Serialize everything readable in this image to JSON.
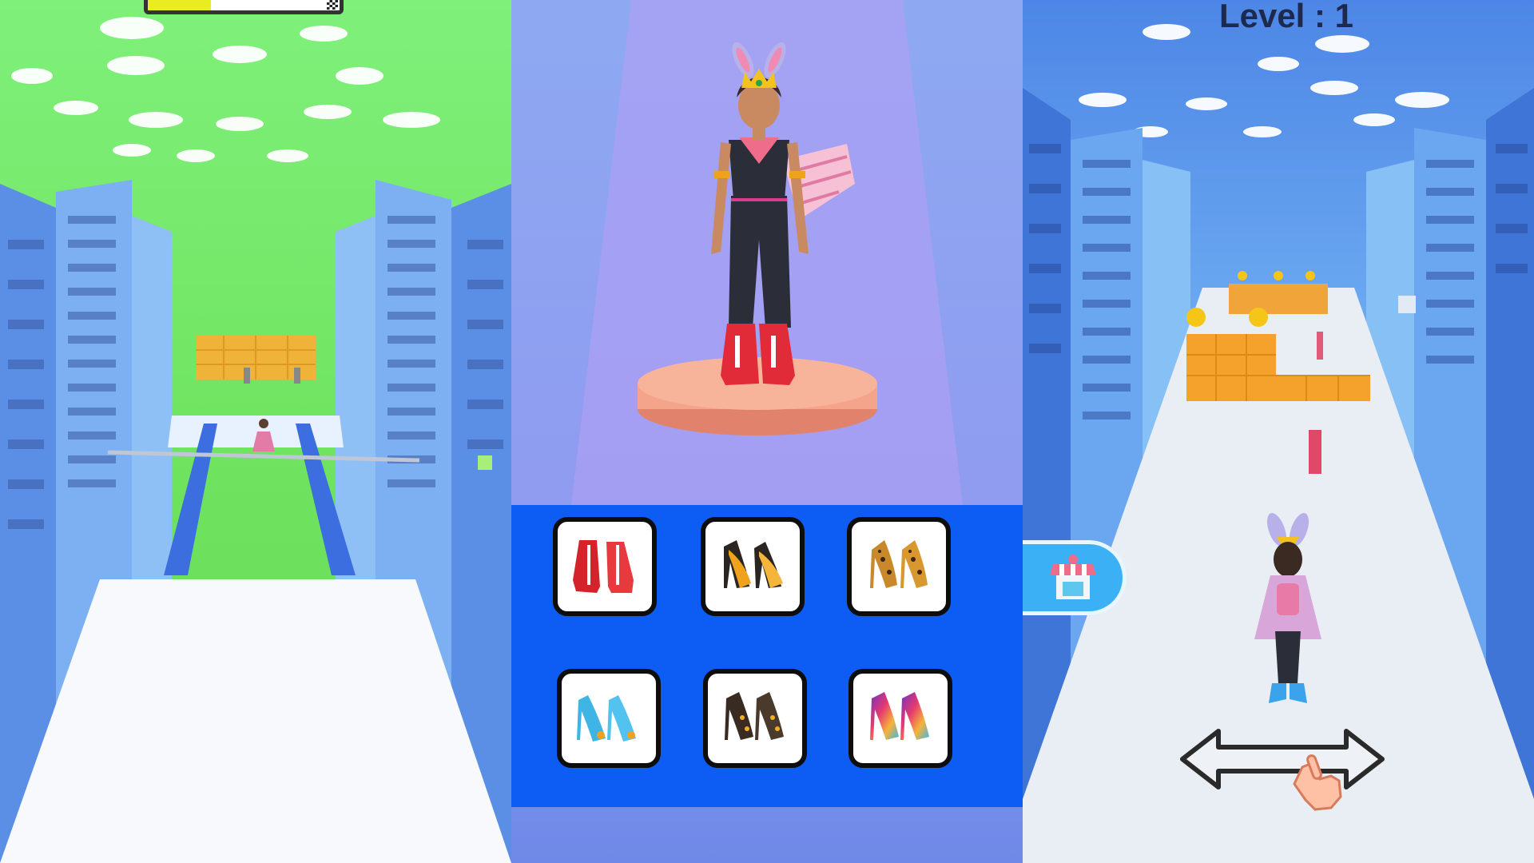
{
  "panels": {
    "left": {
      "progress": {
        "fraction": 0.33
      }
    },
    "middle": {
      "shoe_shop": {
        "items": [
          {
            "icon": "red-ankle-boots-icon",
            "color": "#d4232a"
          },
          {
            "icon": "orange-high-heels-icon",
            "color": "#f0a21c"
          },
          {
            "icon": "leopard-high-heels-icon",
            "color": "#c9892b"
          },
          {
            "icon": "blue-peep-toe-heels-icon",
            "color": "#3fb5e6"
          },
          {
            "icon": "black-gold-heels-icon",
            "color": "#3a2b22"
          },
          {
            "icon": "rainbow-high-heels-icon",
            "color": "#8a3fc9"
          }
        ]
      }
    },
    "right": {
      "level_label": "Level : 1",
      "shop_button_icon": "shop-store-icon",
      "swipe_hint_icon": "swipe-left-right-hand-icon"
    }
  },
  "colors": {
    "shop_panel": "#0d5df5",
    "progress_fill": "#e9ec1f",
    "left_sky": "#7ff07a",
    "right_sky": "#4d86e6"
  }
}
